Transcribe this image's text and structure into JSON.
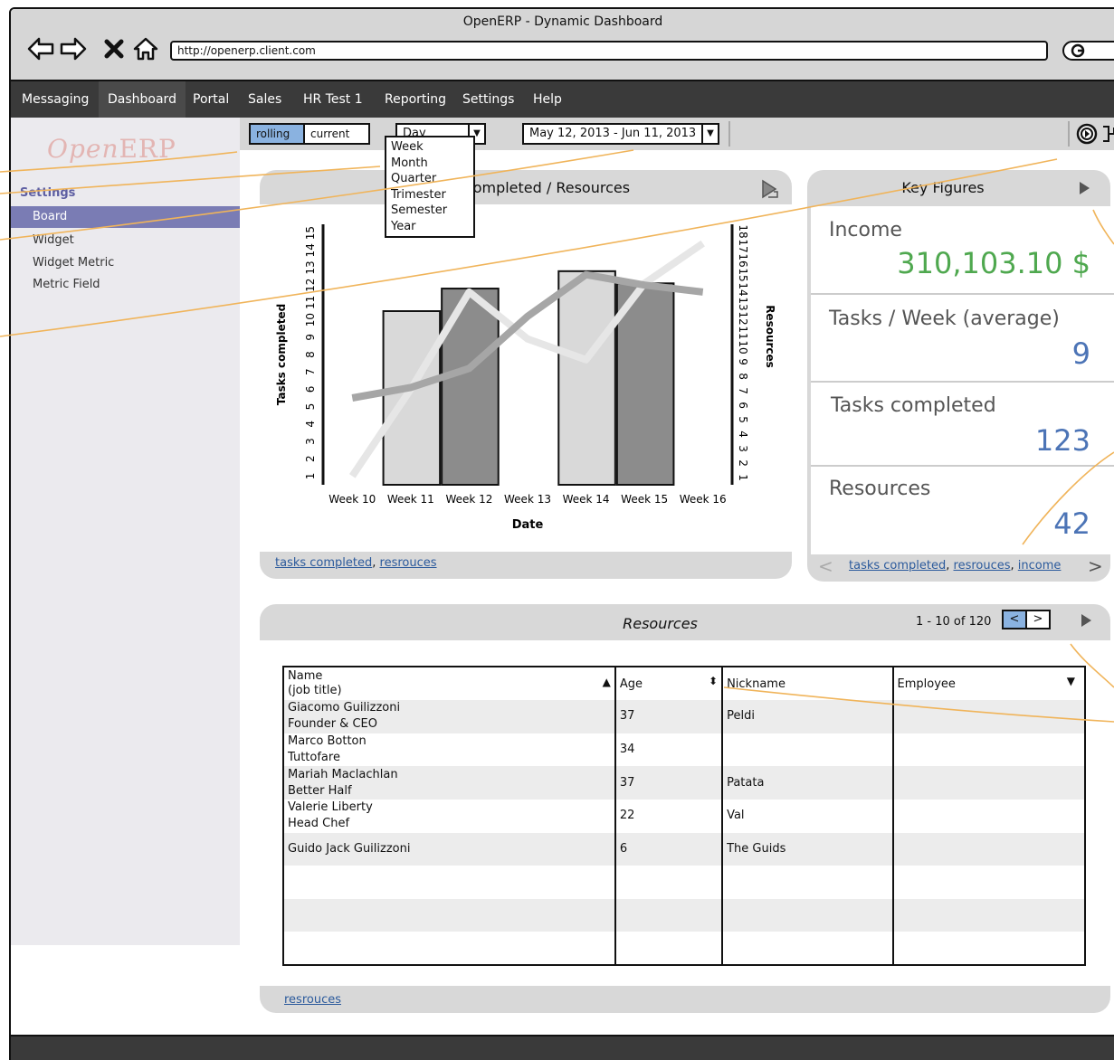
{
  "window": {
    "title": "OpenERP - Dynamic Dashboard",
    "url": "http://openerp.client.com"
  },
  "menu": [
    "Messaging",
    "Dashboard",
    "Portal",
    "Sales",
    "HR Test 1",
    "Reporting",
    "Settings",
    "Help"
  ],
  "sidebar": {
    "logo_open": "Open",
    "logo_erp": "ERP",
    "heading": "Settings",
    "items": [
      "Board",
      "Widget",
      "Widget Metric",
      "Metric Field"
    ],
    "selected": "Board"
  },
  "toolbar": {
    "rolling": "rolling",
    "current": "current",
    "period_value": "Day",
    "period_options": [
      "Week",
      "Month",
      "Quarter",
      "Trimester",
      "Semester",
      "Year"
    ],
    "date_range": "May 12, 2013 - Jun 11, 2013"
  },
  "chart_panel": {
    "title": "Tasks completed / Resources",
    "links": [
      "tasks completed",
      "resrouces"
    ]
  },
  "chart_data": {
    "type": "bar",
    "title": "Tasks completed / Resources",
    "xlabel": "Date",
    "ylabel": "Tasks completed",
    "y2label": "Resources",
    "categories": [
      "Week 10",
      "Week 11",
      "Week 12",
      "Week 13",
      "Week 14",
      "Week 15",
      "Week 16"
    ],
    "yticks": [
      "1",
      "2",
      "3",
      "4",
      "5",
      "6",
      "7",
      "8",
      "9",
      "10",
      "11",
      "12",
      "13",
      "14",
      "15"
    ],
    "y2ticks": [
      "1",
      "2",
      "3",
      "4",
      "5",
      "6",
      "7",
      "8",
      "9",
      "10",
      "11",
      "12",
      "13",
      "14",
      "15",
      "16",
      "17",
      "18"
    ],
    "ylim": [
      0.5,
      15.5
    ],
    "y2lim": [
      0.5,
      18.5
    ],
    "bars": [
      {
        "from": "Week 10.5",
        "to": "Week 11.5",
        "value": 10.5,
        "fill": "#d9d9d9"
      },
      {
        "from": "Week 11.5",
        "to": "Week 12.5",
        "value": 11.8,
        "fill": "#8c8c8c"
      },
      {
        "from": "Week 13.5",
        "to": "Week 14.5",
        "value": 12.8,
        "fill": "#d9d9d9"
      },
      {
        "from": "Week 14.5",
        "to": "Week 15.5",
        "value": 12.1,
        "fill": "#8c8c8c"
      }
    ],
    "bar_values": [
      null,
      10.5,
      11.8,
      null,
      12.8,
      12.1,
      null
    ],
    "series": [
      {
        "color": "#e6e6e6",
        "values": [
          1.0,
          6.0,
          11.6,
          8.9,
          7.7,
          12.1,
          14.4
        ]
      },
      {
        "color": "#a6a6a6",
        "values": [
          5.5,
          6.1,
          7.2,
          10.2,
          12.6,
          12.0,
          11.6
        ]
      }
    ]
  },
  "key_figures": {
    "title": "Key Figures",
    "items": [
      {
        "label": "Income",
        "value": "310,103.10 $",
        "color": "#4fa84f"
      },
      {
        "label": "Tasks / Week (average)",
        "value": "9",
        "color": "#4c74b6"
      },
      {
        "label": "Tasks completed",
        "value": "123",
        "color": "#4c74b6"
      },
      {
        "label": "Resources",
        "value": "42",
        "color": "#4c74b6"
      }
    ],
    "links": [
      "tasks completed",
      "resrouces",
      "income"
    ]
  },
  "resources": {
    "title": "Resources",
    "pager_text": "1 - 10 of 120",
    "prev": "<",
    "next": ">",
    "columns": [
      "Name\n(job title)",
      "Age",
      "Nickname",
      "Employee"
    ],
    "rows": [
      {
        "name": "Giacomo Guilizzoni",
        "title": "Founder & CEO",
        "age": "37",
        "nickname": "Peldi",
        "employee": ""
      },
      {
        "name": "Marco Botton",
        "title": "Tuttofare",
        "age": "34",
        "nickname": "",
        "employee": ""
      },
      {
        "name": "Mariah Maclachlan",
        "title": "Better Half",
        "age": "37",
        "nickname": "Patata",
        "employee": ""
      },
      {
        "name": "Valerie Liberty",
        "title": "Head Chef",
        "age": "22",
        "nickname": "Val",
        "employee": ""
      },
      {
        "name": "Guido Jack Guilizzoni",
        "title": "",
        "age": "6",
        "nickname": "The Guids",
        "employee": ""
      },
      {
        "name": "",
        "title": "",
        "age": "",
        "nickname": "",
        "employee": ""
      },
      {
        "name": "",
        "title": "",
        "age": "",
        "nickname": "",
        "employee": ""
      },
      {
        "name": "",
        "title": "",
        "age": "",
        "nickname": "",
        "employee": ""
      }
    ],
    "link": "resrouces"
  }
}
